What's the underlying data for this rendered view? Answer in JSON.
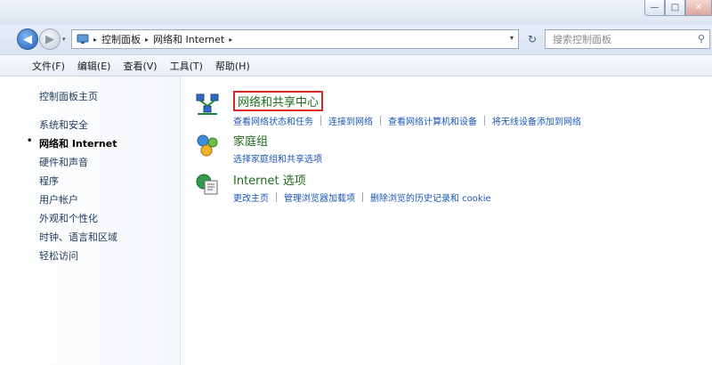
{
  "window": {
    "minimize_glyph": "—",
    "maximize_glyph": "□",
    "close_glyph": "✕"
  },
  "nav": {
    "back_glyph": "◀",
    "forward_glyph": "▶",
    "recent_glyph": "▾",
    "breadcrumbs": [
      "控制面板",
      "网络和 Internet"
    ],
    "crumb_separator": "▸",
    "dropdown_glyph": "▾",
    "refresh_glyph": "↻",
    "search_placeholder": "搜索控制面板",
    "search_glyph": "⚲"
  },
  "menubar": {
    "items": [
      "文件(F)",
      "编辑(E)",
      "查看(V)",
      "工具(T)",
      "帮助(H)"
    ]
  },
  "sidebar": {
    "home": "控制面板主页",
    "items": [
      {
        "label": "系统和安全",
        "current": false
      },
      {
        "label": "网络和 Internet",
        "current": true
      },
      {
        "label": "硬件和声音",
        "current": false
      },
      {
        "label": "程序",
        "current": false
      },
      {
        "label": "用户帐户",
        "current": false
      },
      {
        "label": "外观和个性化",
        "current": false
      },
      {
        "label": "时钟、语言和区域",
        "current": false
      },
      {
        "label": "轻松访问",
        "current": false
      }
    ],
    "bullet": "•"
  },
  "categories": [
    {
      "title": "网络和共享中心",
      "icon": "network-sharing-icon",
      "highlighted": true,
      "links": [
        "查看网络状态和任务",
        "连接到网络",
        "查看网络计算机和设备",
        "将无线设备添加到网络"
      ]
    },
    {
      "title": "家庭组",
      "icon": "homegroup-icon",
      "highlighted": false,
      "links": [
        "选择家庭组和共享选项"
      ]
    },
    {
      "title": "Internet 选项",
      "icon": "internet-options-icon",
      "highlighted": false,
      "links": [
        "更改主页",
        "管理浏览器加载项",
        "删除浏览的历史记录和 cookie"
      ]
    }
  ],
  "colors": {
    "highlight_border": "#d62a2a",
    "category_title": "#1e6b1e",
    "link": "#1d56b5"
  }
}
